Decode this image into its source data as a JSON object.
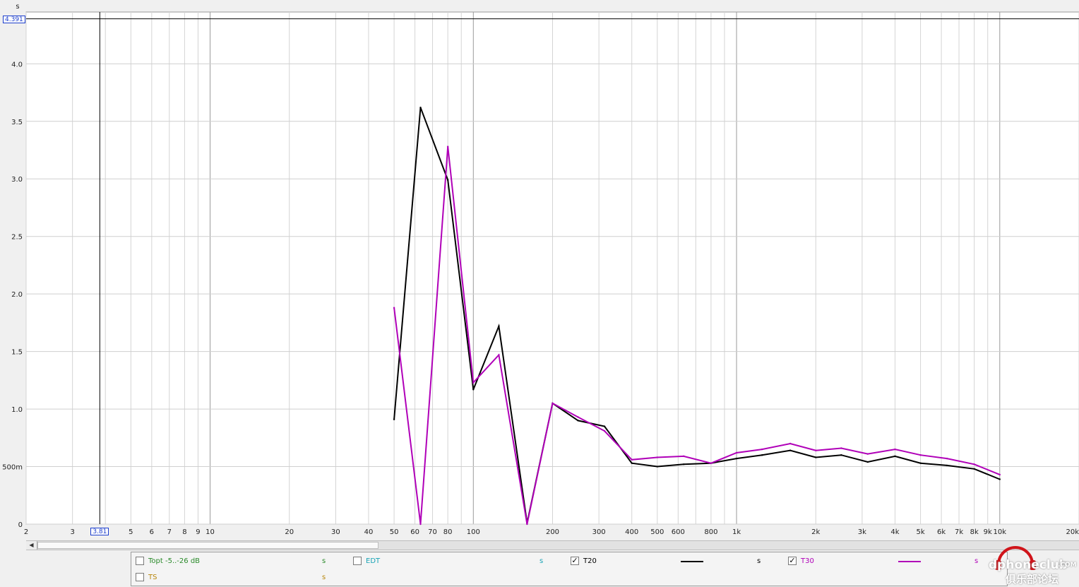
{
  "chart_data": {
    "type": "line",
    "xscale": "log",
    "xlim": [
      2,
      20000
    ],
    "ylim": [
      0,
      4.45
    ],
    "ylabel": "s",
    "grid": true,
    "y_ticks": [
      {
        "value": 0,
        "label": "0"
      },
      {
        "value": 0.5,
        "label": "500m"
      },
      {
        "value": 1.0,
        "label": "1.0"
      },
      {
        "value": 1.5,
        "label": "1.5"
      },
      {
        "value": 2.0,
        "label": "2.0"
      },
      {
        "value": 2.5,
        "label": "2.5"
      },
      {
        "value": 3.0,
        "label": "3.0"
      },
      {
        "value": 3.5,
        "label": "3.5"
      },
      {
        "value": 4.0,
        "label": "4.0"
      }
    ],
    "x_ticks": [
      {
        "value": 2,
        "label": "2"
      },
      {
        "value": 3,
        "label": "3"
      },
      {
        "value": 5,
        "label": "5"
      },
      {
        "value": 6,
        "label": "6"
      },
      {
        "value": 7,
        "label": "7"
      },
      {
        "value": 8,
        "label": "8"
      },
      {
        "value": 9,
        "label": "9"
      },
      {
        "value": 10,
        "label": "10"
      },
      {
        "value": 20,
        "label": "20"
      },
      {
        "value": 30,
        "label": "30"
      },
      {
        "value": 40,
        "label": "40"
      },
      {
        "value": 50,
        "label": "50"
      },
      {
        "value": 60,
        "label": "60"
      },
      {
        "value": 70,
        "label": "70"
      },
      {
        "value": 80,
        "label": "80"
      },
      {
        "value": 100,
        "label": "100"
      },
      {
        "value": 200,
        "label": "200"
      },
      {
        "value": 300,
        "label": "300"
      },
      {
        "value": 400,
        "label": "400"
      },
      {
        "value": 500,
        "label": "500"
      },
      {
        "value": 600,
        "label": "600"
      },
      {
        "value": 800,
        "label": "800"
      },
      {
        "value": 1000,
        "label": "1k"
      },
      {
        "value": 2000,
        "label": "2k"
      },
      {
        "value": 3000,
        "label": "3k"
      },
      {
        "value": 4000,
        "label": "4k"
      },
      {
        "value": 5000,
        "label": "5k"
      },
      {
        "value": 6000,
        "label": "6k"
      },
      {
        "value": 7000,
        "label": "7k"
      },
      {
        "value": 8000,
        "label": "8k"
      },
      {
        "value": 9000,
        "label": "9k"
      },
      {
        "value": 10000,
        "label": "10k"
      },
      {
        "value": 20000,
        "label": "20k"
      }
    ],
    "x_grid_minor": [
      4,
      90,
      900,
      90,
      9000
    ],
    "cursor": {
      "x": 3.81,
      "x_label": "3.81",
      "y": 4.391,
      "y_label": "4.391"
    },
    "series": [
      {
        "name": "T20",
        "color": "#000000",
        "x": [
          50,
          63,
          80,
          100,
          125,
          160,
          200,
          250,
          315,
          400,
          500,
          630,
          800,
          1000,
          1250,
          1600,
          2000,
          2500,
          3150,
          4000,
          5000,
          6300,
          8000,
          10000
        ],
        "values": [
          0.91,
          3.62,
          2.99,
          1.17,
          1.72,
          0.01,
          1.05,
          0.9,
          0.85,
          0.53,
          0.5,
          0.52,
          0.53,
          0.57,
          0.6,
          0.64,
          0.58,
          0.6,
          0.54,
          0.59,
          0.53,
          0.51,
          0.48,
          0.39
        ]
      },
      {
        "name": "T30",
        "color": "#b000b8",
        "x": [
          50,
          63,
          80,
          100,
          125,
          160,
          200,
          250,
          315,
          400,
          500,
          630,
          800,
          1000,
          1250,
          1600,
          2000,
          2500,
          3150,
          4000,
          5000,
          6300,
          8000,
          10000
        ],
        "values": [
          1.88,
          0.0,
          3.28,
          1.23,
          1.47,
          0.0,
          1.05,
          0.93,
          0.81,
          0.56,
          0.58,
          0.59,
          0.53,
          0.62,
          0.65,
          0.7,
          0.64,
          0.66,
          0.61,
          0.65,
          0.6,
          0.57,
          0.52,
          0.43
        ]
      }
    ]
  },
  "scrollbar": {
    "left_arrow": "◀"
  },
  "legend": {
    "items": [
      {
        "label": "Topt -5..-26 dB",
        "unit": "s",
        "checked": false,
        "color": "#2a8a2a"
      },
      {
        "label": "EDT",
        "unit": "s",
        "checked": false,
        "color": "#19a3b5"
      },
      {
        "label": "T20",
        "unit": "s",
        "checked": true,
        "color": "#000000"
      },
      {
        "label": "T30",
        "unit": "s",
        "checked": true,
        "color": "#b000b8"
      },
      {
        "label": "TS",
        "unit": "s",
        "checked": false,
        "color": "#b8860b"
      }
    ],
    "check_glyph": "✓"
  },
  "watermark": {
    "brand": "dphoneclub",
    "suffix": ".COM",
    "cn": "俱乐部论坛"
  }
}
